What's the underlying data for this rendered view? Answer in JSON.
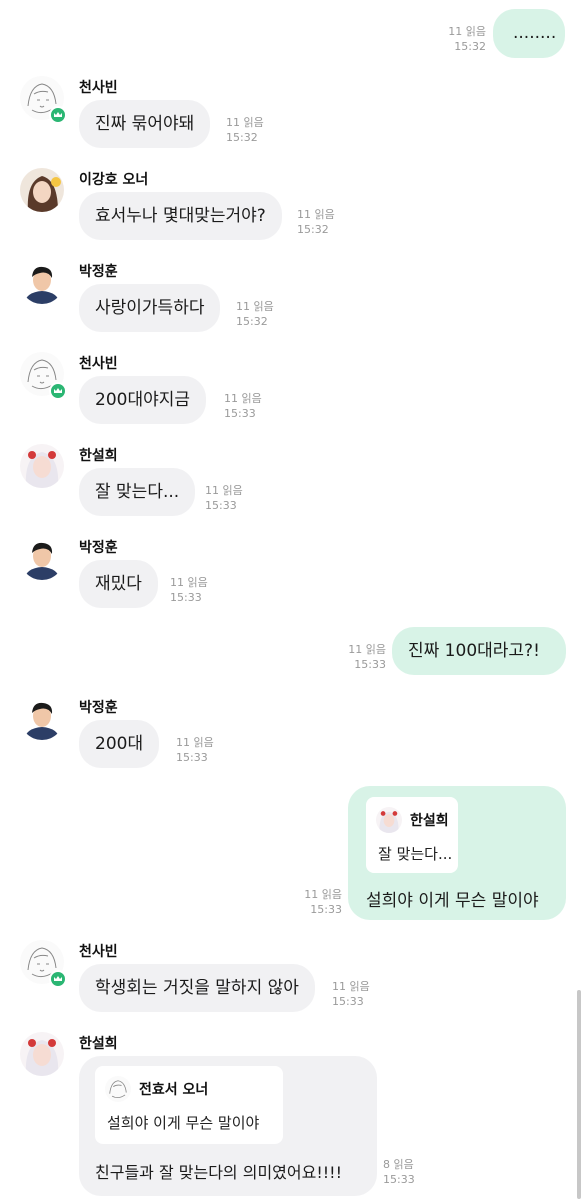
{
  "read_label": "읽음",
  "messages": [
    {
      "sender": "",
      "text": "........",
      "read": "11",
      "time": "15:32"
    },
    {
      "sender": "천사빈",
      "text": "진짜 묶어야돼",
      "read": "11",
      "time": "15:32"
    },
    {
      "sender": "이강호 오너",
      "text": "효서누나 몇대맞는거야?",
      "read": "11",
      "time": "15:32"
    },
    {
      "sender": "박정훈",
      "text": "사랑이가득하다",
      "read": "11",
      "time": "15:32"
    },
    {
      "sender": "천사빈",
      "text": "200대야지금",
      "read": "11",
      "time": "15:33"
    },
    {
      "sender": "한설희",
      "text": "잘 맞는다...",
      "read": "11",
      "time": "15:33"
    },
    {
      "sender": "박정훈",
      "text": "재밌다",
      "read": "11",
      "time": "15:33"
    },
    {
      "sender": "",
      "text": "진짜 100대라고?!",
      "read": "11",
      "time": "15:33"
    },
    {
      "sender": "박정훈",
      "text": "200대",
      "read": "11",
      "time": "15:33"
    },
    {
      "sender": "",
      "text": "설희야 이게 무슨 말이야",
      "read": "11",
      "time": "15:33",
      "quote": {
        "name": "한설희",
        "text": "잘 맞는다..."
      }
    },
    {
      "sender": "천사빈",
      "text": "학생회는 거짓을 말하지 않아",
      "read": "11",
      "time": "15:33"
    },
    {
      "sender": "한설희",
      "text": "친구들과 잘 맞는다의 의미였어요!!!!",
      "read": "8",
      "time": "15:33",
      "quote": {
        "name": "전효서 오너",
        "text": "설희야 이게 무슨 말이야"
      }
    }
  ],
  "colors": {
    "incoming_bubble": "#f1f1f3",
    "outgoing_bubble": "#d8f3e7",
    "badge": "#2bb673",
    "meta_text": "#9a9a9a"
  },
  "icons": {
    "sketch_avatar": "sketch-girl-avatar-icon",
    "boy_avatar": "dark-hair-boy-avatar-icon",
    "long_hair_avatar": "long-brown-hair-avatar-icon",
    "white_hair_avatar": "white-hair-girl-avatar-icon",
    "crown_badge": "crown-badge-icon"
  }
}
